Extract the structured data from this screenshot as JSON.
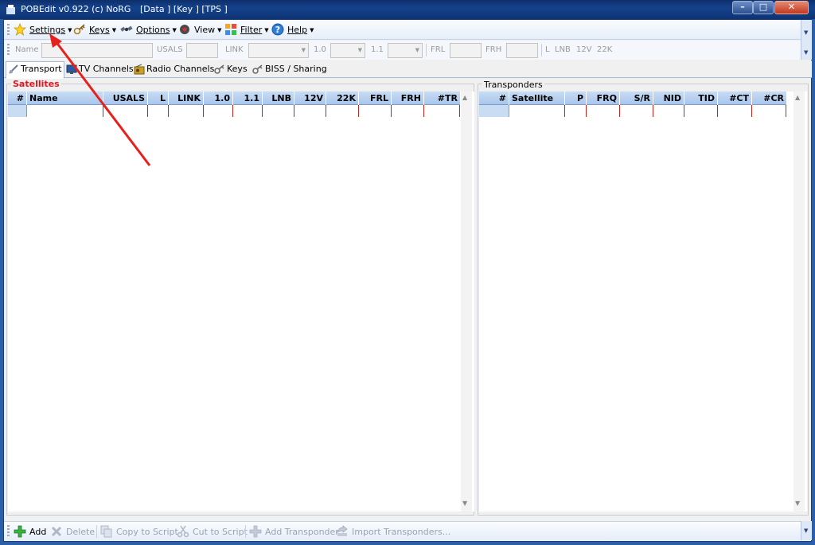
{
  "window": {
    "title": "POBEdit v0.922 (c) NoRG",
    "sections": "[Data ] [Key ] [TPS ]"
  },
  "menu": {
    "settings": "Settings",
    "keys": "Keys",
    "options": "Options",
    "view": "View",
    "filter": "Filter",
    "help": "Help"
  },
  "fields": {
    "name": "Name",
    "usals": "USALS",
    "link": "LINK",
    "v10": "1.0",
    "v11": "1.1",
    "frl": "FRL",
    "frh": "FRH",
    "l": "L",
    "lnb": "LNB",
    "v12": "12V",
    "k22": "22K"
  },
  "tabs": [
    "Transport",
    "TV Channels",
    "Radio Channels",
    "Keys",
    "BISS / Sharing"
  ],
  "satellites": {
    "title": "Satellites",
    "columns": [
      "#",
      "Name",
      "USALS",
      "L",
      "LINK",
      "1.0",
      "1.1",
      "LNB",
      "12V",
      "22K",
      "FRL",
      "FRH",
      "#TR"
    ]
  },
  "transponders": {
    "title": "Transponders",
    "columns": [
      "#",
      "Satellite",
      "P",
      "FRQ",
      "S/R",
      "NID",
      "TID",
      "#CT",
      "#CR"
    ]
  },
  "bottom": {
    "add": "Add",
    "delete": "Delete",
    "copy_script": "Copy to Script",
    "cut_script": "Cut to Script",
    "add_transponder": "Add Transponder",
    "import_transponders": "Import Transponders..."
  },
  "colors": {
    "satellites_title": "#e8141c",
    "annotation_arrow": "#e8201c",
    "header_bg": "#b4cff0"
  }
}
